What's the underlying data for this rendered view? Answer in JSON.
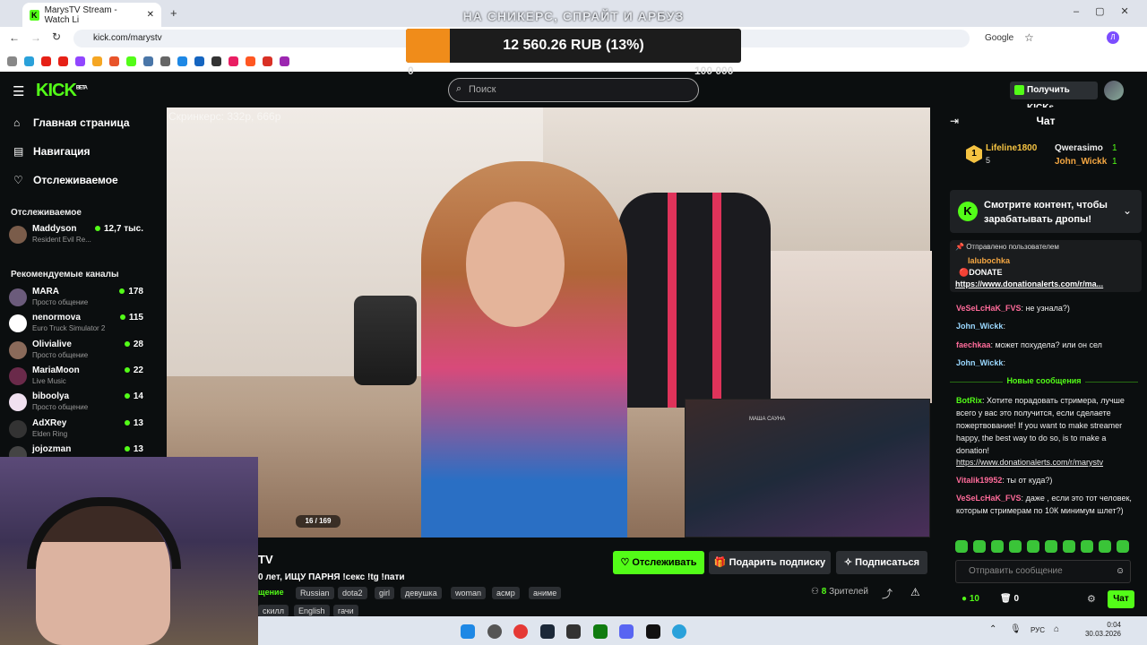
{
  "browser": {
    "tab_title": "MarysTV Stream - Watch Li",
    "url": "kick.com/marystv",
    "google_label": "Google",
    "profile_letter": "Л"
  },
  "overlay": {
    "title": "НА СНИКЕРС, СПРАЙТ И АРБУЗ",
    "goal_text": "12 560.26 RUB (13%)",
    "goal_percent": 13,
    "goal_min": "0",
    "goal_max": "100 000"
  },
  "header": {
    "logo": "KICK",
    "logo_sup": "BETA",
    "search_placeholder": "Поиск",
    "get_kicks": "Получить KICKs"
  },
  "sidebar": {
    "nav": [
      "Главная страница",
      "Навигация",
      "Отслеживаемое"
    ],
    "followed_title": "Отслеживаемое",
    "followed": [
      {
        "name": "Maddyson",
        "game": "Resident Evil Re...",
        "viewers": "12,7 тыс."
      }
    ],
    "recommended_title": "Рекомендуемые каналы",
    "recommended": [
      {
        "name": "MARA",
        "game": "Просто общение",
        "viewers": "178",
        "color": "#6b5b7b"
      },
      {
        "name": "nenormova",
        "game": "Euro Truck Simulator 2",
        "viewers": "115",
        "color": "#ffffff"
      },
      {
        "name": "Olivialive",
        "game": "Просто общение",
        "viewers": "28",
        "color": "#8a6a5a"
      },
      {
        "name": "MariaMoon",
        "game": "Live Music",
        "viewers": "22",
        "color": "#6a2a4a"
      },
      {
        "name": "biboolya",
        "game": "Просто общение",
        "viewers": "14",
        "color": "#f0e0f0"
      },
      {
        "name": "AdXRey",
        "game": "Elden Ring",
        "viewers": "13",
        "color": "#333333"
      },
      {
        "name": "jojozman",
        "game": "",
        "viewers": "13",
        "color": "#444444"
      }
    ]
  },
  "video": {
    "watermark": "Скринкерс: 332р, 666р",
    "pip_title": "МАША САУНА",
    "counter": "16 / 169"
  },
  "stream": {
    "channel": "TV",
    "title": "0 лет, ИЩУ ПАРНЯ !секс !tg !пати",
    "category": "щение",
    "tags_row1": [
      "Russian",
      "dota2",
      "girl",
      "девушка",
      "woman",
      "асмр",
      "аниме"
    ],
    "tags_row2": [
      "скилл",
      "English",
      "гачи"
    ],
    "follow": "Отслеживать",
    "gift": "Подарить подписку",
    "subscribe": "Подписаться",
    "viewers_count": "8",
    "viewers_label": "Зрителей"
  },
  "chat": {
    "title": "Чат",
    "leaderboard": [
      {
        "name": "Lifeline1800",
        "score": "5",
        "rank": "1"
      },
      {
        "name": "Qwerasimo",
        "score": "1"
      },
      {
        "name": "John_Wickk",
        "score": "1"
      }
    ],
    "drops_text": "Смотрите контент, чтобы зарабатывать дропы!",
    "pinned_by": "Отправлено пользователем",
    "pinned_user": "lalubochka",
    "pinned_donate": "DONATE",
    "pinned_link": "https://www.donationalerts.com/r/ma...",
    "new_messages": "Новые сообщения",
    "messages_old": [
      {
        "user": "VeSeLcHaK_FVS",
        "text": "не узнала?)",
        "color": "#ff6b9a"
      },
      {
        "user": "John_Wickk",
        "text": "",
        "color": "#9ad8ff"
      },
      {
        "user": "faechkaa",
        "text": "может похудела? или он сел",
        "color": "#ff6b9a"
      },
      {
        "user": "John_Wickk",
        "text": "",
        "color": "#9ad8ff"
      }
    ],
    "bot_user": "BotRix",
    "bot_text": "Хотите порадовать стримера, лучше всего у вас это получится, если сделаете пожертвование! If you want to make streamer happy, the best way to do so, is to make a donation!",
    "bot_link": "https://www.donationalerts.com/r/marystv",
    "messages_new": [
      {
        "user": "Vitalik19952",
        "text": "ты от куда?)",
        "color": "#ff6b9a"
      },
      {
        "user": "VeSeLcHaK_FVS",
        "text": "даже , если это тот человек, которым стримерам по 10К минимум шлет?)",
        "color": "#ff6b9a"
      }
    ],
    "input_placeholder": "Отправить сообщение",
    "points": "10",
    "points2": "0",
    "send": "Чат"
  },
  "taskbar": {
    "lang": "РУС",
    "time": "0:04",
    "date": "30.03.2026"
  }
}
